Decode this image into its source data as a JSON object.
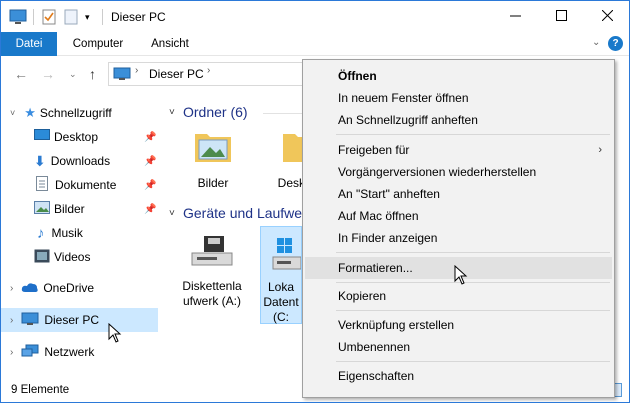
{
  "window": {
    "title": "Dieser PC",
    "controls": {
      "minimize": "minimize-icon",
      "maximize": "maximize-icon",
      "close": "close-icon"
    }
  },
  "ribbon": {
    "tabs": [
      "Datei",
      "Computer",
      "Ansicht"
    ],
    "file_tab_color": "#1979ca"
  },
  "address": {
    "crumbs": [
      "Dieser PC"
    ]
  },
  "nav": {
    "items": [
      {
        "label": "Schnellzugriff",
        "icon": "star-icon",
        "pinned": false
      },
      {
        "label": "Desktop",
        "icon": "desktop-icon",
        "pinned": true
      },
      {
        "label": "Downloads",
        "icon": "download-icon",
        "pinned": true
      },
      {
        "label": "Dokumente",
        "icon": "document-icon",
        "pinned": true
      },
      {
        "label": "Bilder",
        "icon": "image-icon",
        "pinned": true
      },
      {
        "label": "Musik",
        "icon": "music-icon",
        "pinned": false
      },
      {
        "label": "Videos",
        "icon": "video-icon",
        "pinned": false
      },
      {
        "label": "OneDrive",
        "icon": "cloud-icon",
        "pinned": false
      },
      {
        "label": "Dieser PC",
        "icon": "computer-icon",
        "pinned": false
      },
      {
        "label": "Netzwerk",
        "icon": "network-icon",
        "pinned": false
      }
    ]
  },
  "content": {
    "group_folders": "Ordner (6)",
    "group_devices": "Geräte und Laufwe",
    "folders": [
      "Bilder",
      "Deskt"
    ],
    "devices": [
      {
        "line1": "Diskettenla",
        "line2": "ufwerk (A:)"
      },
      {
        "line1": "Loka",
        "line2": "Datent",
        "line3": "(C:"
      }
    ]
  },
  "status": {
    "count": "9 Elemente"
  },
  "context_menu": {
    "items": [
      {
        "label": "Öffnen",
        "bold": true
      },
      {
        "label": "In neuem Fenster öffnen"
      },
      {
        "label": "An Schnellzugriff anheften"
      },
      {
        "label": "Freigeben für",
        "submenu": true
      },
      {
        "label": "Vorgängerversionen wiederherstellen"
      },
      {
        "label": "An \"Start\" anheften"
      },
      {
        "label": "Auf Mac öffnen"
      },
      {
        "label": "In Finder anzeigen"
      },
      {
        "label": "Formatieren...",
        "hover": true
      },
      {
        "label": "Kopieren"
      },
      {
        "label": "Verknüpfung erstellen"
      },
      {
        "label": "Umbenennen"
      },
      {
        "label": "Eigenschaften"
      }
    ]
  }
}
